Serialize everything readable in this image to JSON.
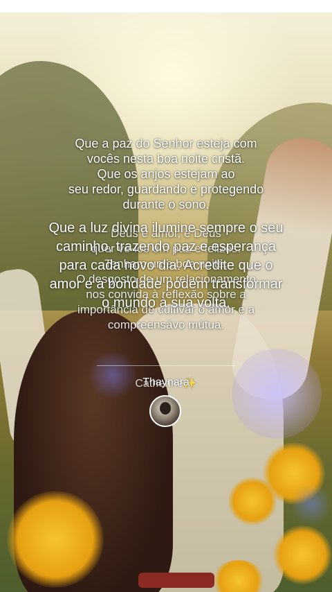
{
  "post": {
    "paragraph1": [
      "Que a paz do Senhor esteja com",
      "vocês nesta boa noite cristã.",
      "Que os anjos estejam ao",
      "seu redor, guardando e protegendo",
      "durante o sono."
    ],
    "paragraph2": [
      "Que a luz divina ilumine sempre o seu",
      "caminho, trazendo paz e esperança",
      "para cada novo dia. Acredite que o",
      "amor e a bondade podem transformar",
      "o mundo à sua volta."
    ],
    "paragraph3": [
      "Deus é amor, e Deus",
      "quer vê-los em paz e felizes.",
      "Tenham uma boa noite.",
      "O desgosto de um relacionamento",
      "nos convida à reflexão sobre a",
      "importância de cultivar o amor e a",
      "compreensávo mútua."
    ]
  },
  "author": {
    "name_front": "Thaynara",
    "name_back": "Catherine✨"
  },
  "colors": {
    "text": "#ffffff",
    "top_bar": "#ffffff"
  }
}
